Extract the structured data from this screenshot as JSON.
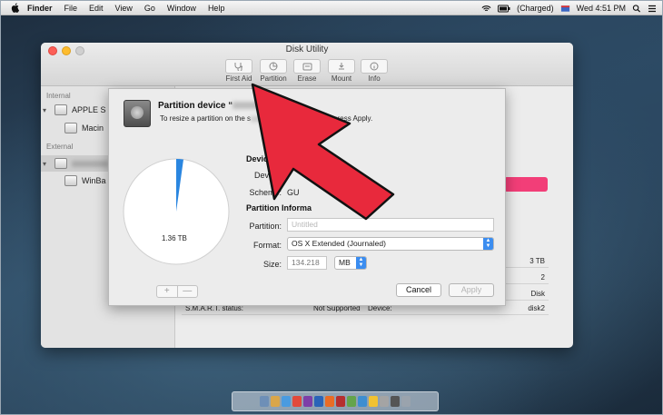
{
  "menubar": {
    "items": [
      "Finder",
      "File",
      "Edit",
      "View",
      "Go",
      "Window",
      "Help"
    ],
    "battery": "(Charged)",
    "clock": "Wed 4:51 PM"
  },
  "window": {
    "title": "Disk Utility",
    "toolbar": [
      "First Aid",
      "Partition",
      "Erase",
      "Mount",
      "Info"
    ]
  },
  "sidebar": {
    "internal_header": "Internal",
    "internal_items": [
      "APPLE S",
      "Macin"
    ],
    "external_header": "External",
    "external_items": [
      "WinBa"
    ]
  },
  "info_table": {
    "rows": [
      {
        "left": "",
        "right": "3 TB"
      },
      {
        "left": "",
        "right": "2"
      },
      {
        "left": "",
        "right": "Disk"
      },
      {
        "left": "S.M.A.R.T. status:",
        "mid": "Not Supported",
        "mid2": "Device:",
        "right": "disk2"
      }
    ]
  },
  "sheet": {
    "title": "Partition device “",
    "title_end": "”?",
    "subtitle": "To resize a partition on the s",
    "subtitle_end": "nd press Apply.",
    "pie_label": "1.36 TB",
    "device_section": "Device I",
    "device_label": "Device:",
    "scheme_label": "Scheme:",
    "scheme_value": "GU",
    "scheme_value_end": "rtition Ma",
    "partition_section": "Partition Informa",
    "partition_label": "Partition:",
    "partition_placeholder": "Untitled",
    "format_label": "Format:",
    "format_value": "OS X Extended (Journaled)",
    "size_label": "Size:",
    "size_value": "134.218",
    "size_unit": "MB",
    "plus": "+",
    "minus": "—",
    "cancel": "Cancel",
    "apply": "Apply"
  },
  "colors": {
    "arrow": "#e8293c",
    "accent": "#3b8df0",
    "pink": "#f23e78"
  }
}
